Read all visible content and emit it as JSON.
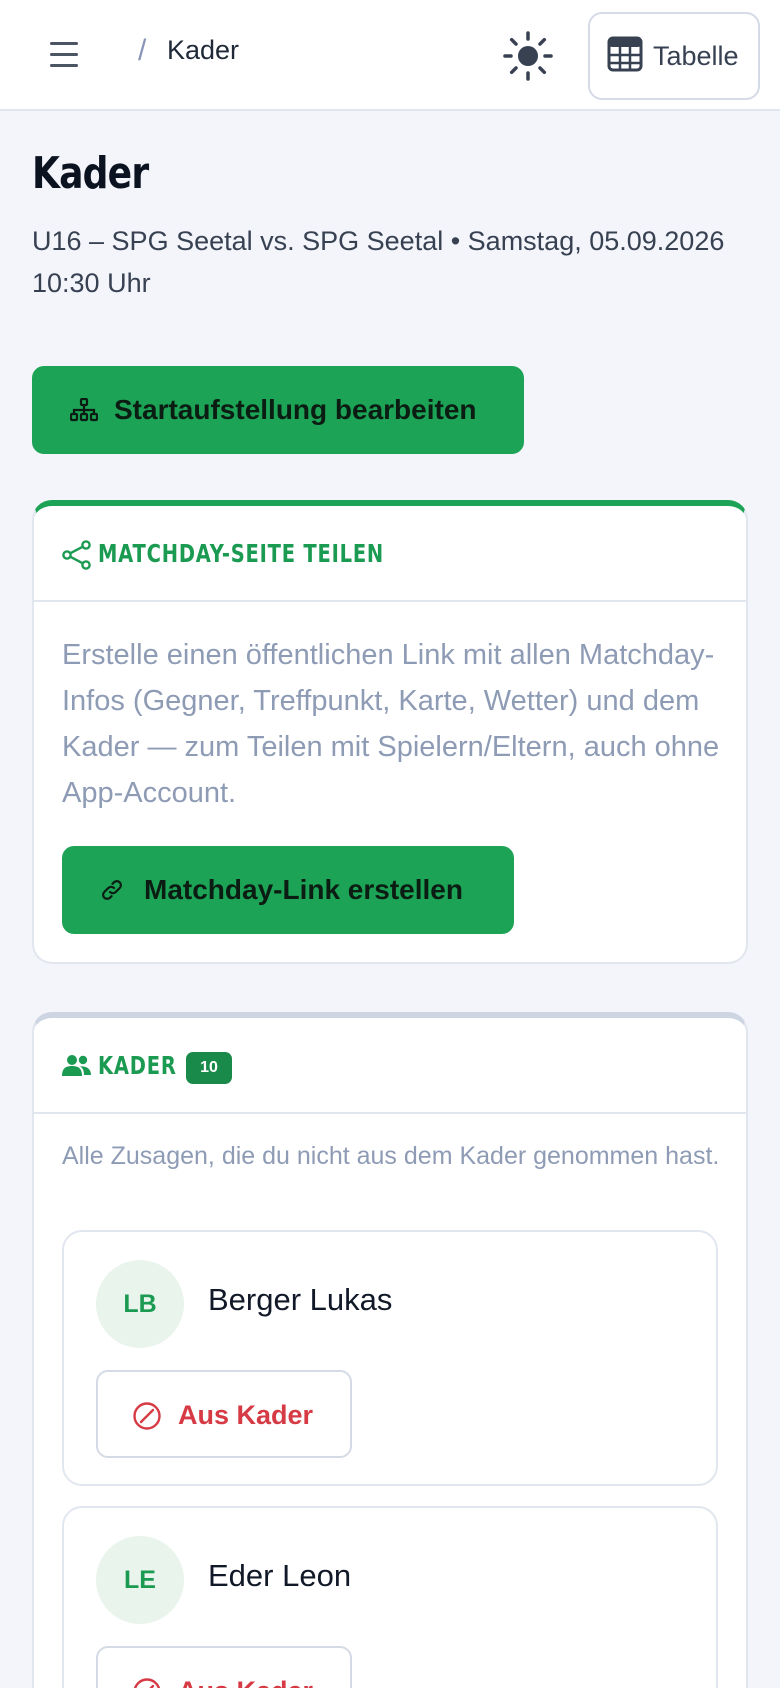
{
  "header": {
    "breadcrumb_sep": "/",
    "breadcrumb_current": "Kader",
    "table_button_label": "Tabelle"
  },
  "page": {
    "title": "Kader",
    "subtitle": "U16 – SPG Seetal vs. SPG Seetal • Samstag, 05.09.2026 10:30 Uhr",
    "lineup_button_label": "Startaufstellung bearbeiten"
  },
  "share_card": {
    "title": "MATCHDAY-SEITE TEILEN",
    "description": "Erstelle einen öffentlichen Link mit allen Matchday-Infos (Gegner, Treffpunkt, Karte, Wetter) und dem Kader — zum Teilen mit Spielern/Eltern, auch ohne App-Account.",
    "button_label": "Matchday-Link erstellen"
  },
  "kader_card": {
    "title": "KADER",
    "count": "10",
    "note": "Alle Zusagen, die du nicht aus dem Kader genommen hast.",
    "players": [
      {
        "initials": "LB",
        "name": "Berger Lukas",
        "action_label": "Aus Kader"
      },
      {
        "initials": "LE",
        "name": "Eder Leon",
        "action_label": "Aus Kader"
      }
    ]
  },
  "colors": {
    "accent_green": "#1ca356",
    "title_green": "#1b9a52",
    "danger_red": "#d63a44",
    "share_card_top_border": "#1ca356",
    "kader_card_top_border": "#cdd5e3"
  },
  "icons": {
    "menu": "hamburger-icon",
    "theme": "sun-icon",
    "table": "table-icon",
    "lineup": "sitemap-icon",
    "share": "share-icon",
    "link": "link-icon",
    "kader": "users-icon",
    "remove": "ban-icon"
  }
}
